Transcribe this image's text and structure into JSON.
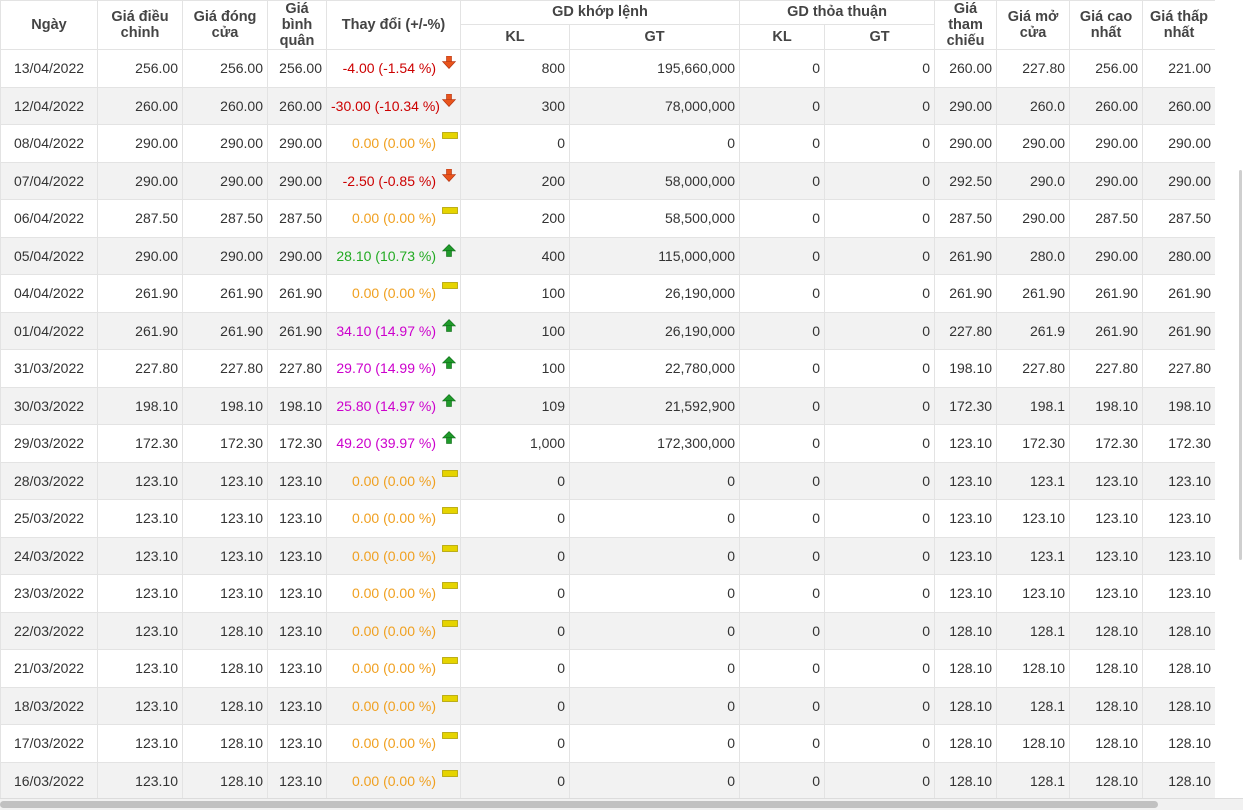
{
  "headers": {
    "date": "Ngày",
    "adj_price": "Giá điều chỉnh",
    "close_price": "Giá đóng cửa",
    "avg_price": "Giá bình quân",
    "change": "Thay đổi (+/-%)",
    "matched_group": "GD khớp lệnh",
    "matched_kl": "KL",
    "matched_gt": "GT",
    "deal_group": "GD thỏa thuận",
    "deal_kl": "KL",
    "deal_gt": "GT",
    "ref_price": "Giá tham chiếu",
    "open_price": "Giá mở cửa",
    "high_price": "Giá cao nhất",
    "low_price": "Giá thấp nhất"
  },
  "colors": {
    "down": "#cc0000",
    "flat": "#f0a020",
    "up": "#22aa22",
    "ceiling": "#cc00cc"
  },
  "rows": [
    {
      "date": "13/04/2022",
      "adj": "256.00",
      "close": "256.00",
      "avg": "256.00",
      "change": "-4.00 (-1.54 %)",
      "dir": "down",
      "kl": "800",
      "gt": "195,660,000",
      "dkl": "0",
      "dgt": "0",
      "ref": "260.00",
      "open": "227.80",
      "high": "256.00",
      "low": "221.00"
    },
    {
      "date": "12/04/2022",
      "adj": "260.00",
      "close": "260.00",
      "avg": "260.00",
      "change": "-30.00 (-10.34 %)",
      "dir": "down",
      "kl": "300",
      "gt": "78,000,000",
      "dkl": "0",
      "dgt": "0",
      "ref": "290.00",
      "open": "260.0",
      "high": "260.00",
      "low": "260.00"
    },
    {
      "date": "08/04/2022",
      "adj": "290.00",
      "close": "290.00",
      "avg": "290.00",
      "change": "0.00 (0.00 %)",
      "dir": "flat",
      "kl": "0",
      "gt": "0",
      "dkl": "0",
      "dgt": "0",
      "ref": "290.00",
      "open": "290.00",
      "high": "290.00",
      "low": "290.00"
    },
    {
      "date": "07/04/2022",
      "adj": "290.00",
      "close": "290.00",
      "avg": "290.00",
      "change": "-2.50 (-0.85 %)",
      "dir": "down",
      "kl": "200",
      "gt": "58,000,000",
      "dkl": "0",
      "dgt": "0",
      "ref": "292.50",
      "open": "290.0",
      "high": "290.00",
      "low": "290.00"
    },
    {
      "date": "06/04/2022",
      "adj": "287.50",
      "close": "287.50",
      "avg": "287.50",
      "change": "0.00 (0.00 %)",
      "dir": "flat",
      "kl": "200",
      "gt": "58,500,000",
      "dkl": "0",
      "dgt": "0",
      "ref": "287.50",
      "open": "290.00",
      "high": "287.50",
      "low": "287.50"
    },
    {
      "date": "05/04/2022",
      "adj": "290.00",
      "close": "290.00",
      "avg": "290.00",
      "change": "28.10 (10.73 %)",
      "dir": "up",
      "kl": "400",
      "gt": "115,000,000",
      "dkl": "0",
      "dgt": "0",
      "ref": "261.90",
      "open": "280.0",
      "high": "290.00",
      "low": "280.00"
    },
    {
      "date": "04/04/2022",
      "adj": "261.90",
      "close": "261.90",
      "avg": "261.90",
      "change": "0.00 (0.00 %)",
      "dir": "flat",
      "kl": "100",
      "gt": "26,190,000",
      "dkl": "0",
      "dgt": "0",
      "ref": "261.90",
      "open": "261.90",
      "high": "261.90",
      "low": "261.90"
    },
    {
      "date": "01/04/2022",
      "adj": "261.90",
      "close": "261.90",
      "avg": "261.90",
      "change": "34.10 (14.97 %)",
      "dir": "ceiling",
      "kl": "100",
      "gt": "26,190,000",
      "dkl": "0",
      "dgt": "0",
      "ref": "227.80",
      "open": "261.9",
      "high": "261.90",
      "low": "261.90"
    },
    {
      "date": "31/03/2022",
      "adj": "227.80",
      "close": "227.80",
      "avg": "227.80",
      "change": "29.70 (14.99 %)",
      "dir": "ceiling",
      "kl": "100",
      "gt": "22,780,000",
      "dkl": "0",
      "dgt": "0",
      "ref": "198.10",
      "open": "227.80",
      "high": "227.80",
      "low": "227.80"
    },
    {
      "date": "30/03/2022",
      "adj": "198.10",
      "close": "198.10",
      "avg": "198.10",
      "change": "25.80 (14.97 %)",
      "dir": "ceiling",
      "kl": "109",
      "gt": "21,592,900",
      "dkl": "0",
      "dgt": "0",
      "ref": "172.30",
      "open": "198.1",
      "high": "198.10",
      "low": "198.10"
    },
    {
      "date": "29/03/2022",
      "adj": "172.30",
      "close": "172.30",
      "avg": "172.30",
      "change": "49.20 (39.97 %)",
      "dir": "ceiling",
      "kl": "1,000",
      "gt": "172,300,000",
      "dkl": "0",
      "dgt": "0",
      "ref": "123.10",
      "open": "172.30",
      "high": "172.30",
      "low": "172.30"
    },
    {
      "date": "28/03/2022",
      "adj": "123.10",
      "close": "123.10",
      "avg": "123.10",
      "change": "0.00 (0.00 %)",
      "dir": "flat",
      "kl": "0",
      "gt": "0",
      "dkl": "0",
      "dgt": "0",
      "ref": "123.10",
      "open": "123.1",
      "high": "123.10",
      "low": "123.10"
    },
    {
      "date": "25/03/2022",
      "adj": "123.10",
      "close": "123.10",
      "avg": "123.10",
      "change": "0.00 (0.00 %)",
      "dir": "flat",
      "kl": "0",
      "gt": "0",
      "dkl": "0",
      "dgt": "0",
      "ref": "123.10",
      "open": "123.10",
      "high": "123.10",
      "low": "123.10"
    },
    {
      "date": "24/03/2022",
      "adj": "123.10",
      "close": "123.10",
      "avg": "123.10",
      "change": "0.00 (0.00 %)",
      "dir": "flat",
      "kl": "0",
      "gt": "0",
      "dkl": "0",
      "dgt": "0",
      "ref": "123.10",
      "open": "123.1",
      "high": "123.10",
      "low": "123.10"
    },
    {
      "date": "23/03/2022",
      "adj": "123.10",
      "close": "123.10",
      "avg": "123.10",
      "change": "0.00 (0.00 %)",
      "dir": "flat",
      "kl": "0",
      "gt": "0",
      "dkl": "0",
      "dgt": "0",
      "ref": "123.10",
      "open": "123.10",
      "high": "123.10",
      "low": "123.10"
    },
    {
      "date": "22/03/2022",
      "adj": "123.10",
      "close": "128.10",
      "avg": "123.10",
      "change": "0.00 (0.00 %)",
      "dir": "flat",
      "kl": "0",
      "gt": "0",
      "dkl": "0",
      "dgt": "0",
      "ref": "128.10",
      "open": "128.1",
      "high": "128.10",
      "low": "128.10"
    },
    {
      "date": "21/03/2022",
      "adj": "123.10",
      "close": "128.10",
      "avg": "123.10",
      "change": "0.00 (0.00 %)",
      "dir": "flat",
      "kl": "0",
      "gt": "0",
      "dkl": "0",
      "dgt": "0",
      "ref": "128.10",
      "open": "128.10",
      "high": "128.10",
      "low": "128.10"
    },
    {
      "date": "18/03/2022",
      "adj": "123.10",
      "close": "128.10",
      "avg": "123.10",
      "change": "0.00 (0.00 %)",
      "dir": "flat",
      "kl": "0",
      "gt": "0",
      "dkl": "0",
      "dgt": "0",
      "ref": "128.10",
      "open": "128.1",
      "high": "128.10",
      "low": "128.10"
    },
    {
      "date": "17/03/2022",
      "adj": "123.10",
      "close": "128.10",
      "avg": "123.10",
      "change": "0.00 (0.00 %)",
      "dir": "flat",
      "kl": "0",
      "gt": "0",
      "dkl": "0",
      "dgt": "0",
      "ref": "128.10",
      "open": "128.10",
      "high": "128.10",
      "low": "128.10"
    },
    {
      "date": "16/03/2022",
      "adj": "123.10",
      "close": "128.10",
      "avg": "123.10",
      "change": "0.00 (0.00 %)",
      "dir": "flat",
      "kl": "0",
      "gt": "0",
      "dkl": "0",
      "dgt": "0",
      "ref": "128.10",
      "open": "128.1",
      "high": "128.10",
      "low": "128.10"
    }
  ]
}
